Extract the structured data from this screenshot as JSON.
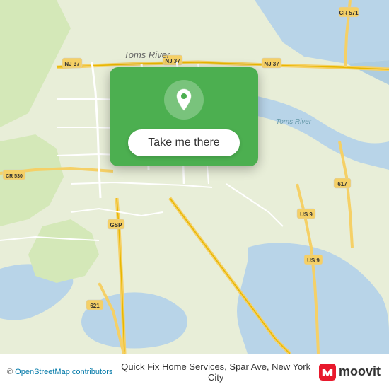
{
  "map": {
    "background_color": "#e8f0e0"
  },
  "popup": {
    "button_label": "Take me there",
    "background_color": "#4CAF50"
  },
  "bottom_bar": {
    "osm_prefix": "© ",
    "osm_link_text": "OpenStreetMap contributors",
    "location_label": "Quick Fix Home Services, Spar Ave, New York City",
    "moovit_text": "moovit"
  }
}
